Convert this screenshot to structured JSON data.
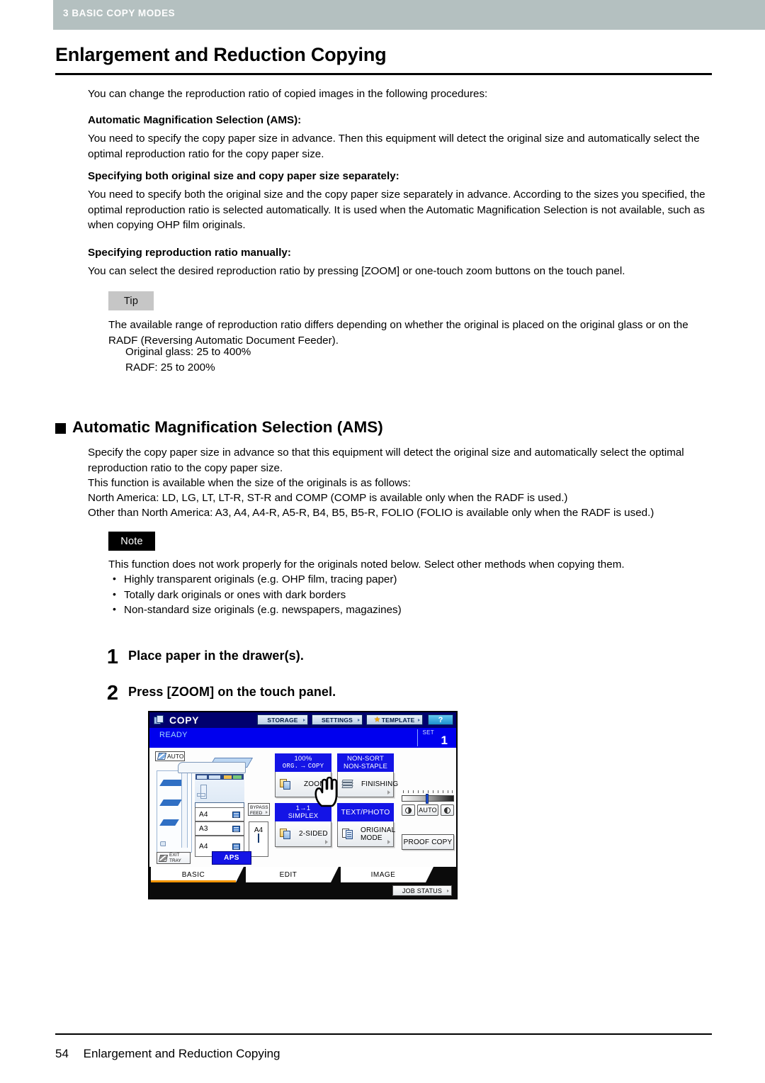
{
  "header": {
    "chapter_label": "3 BASIC COPY MODES"
  },
  "title": "Enlargement and Reduction Copying",
  "intro": "You can change the reproduction ratio of copied images in the following procedures:",
  "sections": [
    {
      "heading": "Automatic Magnification Selection (AMS):",
      "body": "You need to specify the copy paper size in advance. Then this equipment will detect the original size and automatically select the optimal reproduction ratio for the copy paper size."
    },
    {
      "heading": "Specifying both original size and copy paper size separately:",
      "body": "You need to specify both the original size and the copy paper size separately in advance. According to the sizes you specified, the optimal reproduction ratio is selected automatically. It is used when the Automatic Magnification Selection is not available, such as when copying OHP film originals."
    },
    {
      "heading": "Specifying reproduction ratio manually:",
      "body": "You can select the desired reproduction ratio by pressing [ZOOM] or one-touch zoom buttons on the touch panel."
    }
  ],
  "tip": {
    "label": "Tip",
    "body": "The available range of reproduction ratio differs depending on whether the original is placed on the original glass or on the RADF (Reversing Automatic Document Feeder).",
    "items": [
      "Original glass: 25 to 400%",
      "RADF: 25 to 200%"
    ]
  },
  "ams_section": {
    "heading": "Automatic Magnification Selection (AMS)",
    "paragraph": "Specify the copy paper size in advance so that this equipment will detect the original size and automatically select the optimal reproduction ratio to the copy paper size.",
    "line2": "This function is available when the size of the originals is as follows:",
    "line3": "North America: LD, LG, LT, LT-R, ST-R and COMP (COMP is available only when the RADF is used.)",
    "line4": "Other than North America: A3, A4, A4-R, A5-R, B4, B5, B5-R, FOLIO (FOLIO is available only when the RADF is used.)"
  },
  "note": {
    "label": "Note",
    "body": "This function does not work properly for the originals noted below. Select other methods when copying them.",
    "items": [
      "Highly transparent originals (e.g. OHP film, tracing paper)",
      "Totally dark originals or ones with dark borders",
      "Non-standard size originals (e.g. newspapers, magazines)"
    ]
  },
  "steps": [
    {
      "number": "1",
      "text": "Place paper in the drawer(s)."
    },
    {
      "number": "2",
      "text": "Press [ZOOM] on the touch panel."
    }
  ],
  "touch_panel": {
    "title": "COPY",
    "top_buttons": [
      {
        "label": "STORAGE"
      },
      {
        "label": "SETTINGS"
      },
      {
        "label": "TEMPLATE"
      }
    ],
    "help_label": "?",
    "status": "READY",
    "set_label": "SET",
    "set_value": "1",
    "auto_badge": "AUTO",
    "drawers": [
      {
        "size": "A4"
      },
      {
        "size": "A3"
      },
      {
        "size": "A4"
      }
    ],
    "bypass_label_l1": "BYPASS",
    "bypass_label_l2": "FEED",
    "side_tray_size": "A4",
    "exit_tray_l1": "EXIT",
    "exit_tray_l2": "TRAY",
    "aps_label": "APS",
    "functions": {
      "zoom": {
        "cap_l1": "100%",
        "cap_l2_left": "ORG.",
        "cap_l2_arrow": "→",
        "cap_l2_right": "COPY",
        "btn_label": "ZOOM"
      },
      "finishing": {
        "cap_l1": "NON-SORT",
        "cap_l2": "NON-STAPLE",
        "btn_label": "FINISHING"
      },
      "duplex": {
        "cap_l1": "1→1",
        "cap_l2": "SIMPLEX",
        "btn_label": "2-SIDED"
      },
      "original": {
        "cap_l1": "TEXT/PHOTO",
        "btn_label_l1": "ORIGINAL",
        "btn_label_l2": "MODE"
      }
    },
    "density_auto_label": "AUTO",
    "proof_copy_label": "PROOF COPY",
    "tabs": [
      {
        "label": "BASIC",
        "active": true
      },
      {
        "label": "EDIT",
        "active": false
      },
      {
        "label": "IMAGE",
        "active": false
      }
    ],
    "job_status_label": "JOB STATUS"
  },
  "footer": {
    "page_number": "54",
    "text": "Enlargement and Reduction Copying"
  },
  "colors": {
    "chapter_bar": "#b4c0c0",
    "panel_navy": "#00006e",
    "panel_blue": "#0000ee",
    "button_blue": "#1414e6",
    "tab_active_underline": "#f29400"
  }
}
